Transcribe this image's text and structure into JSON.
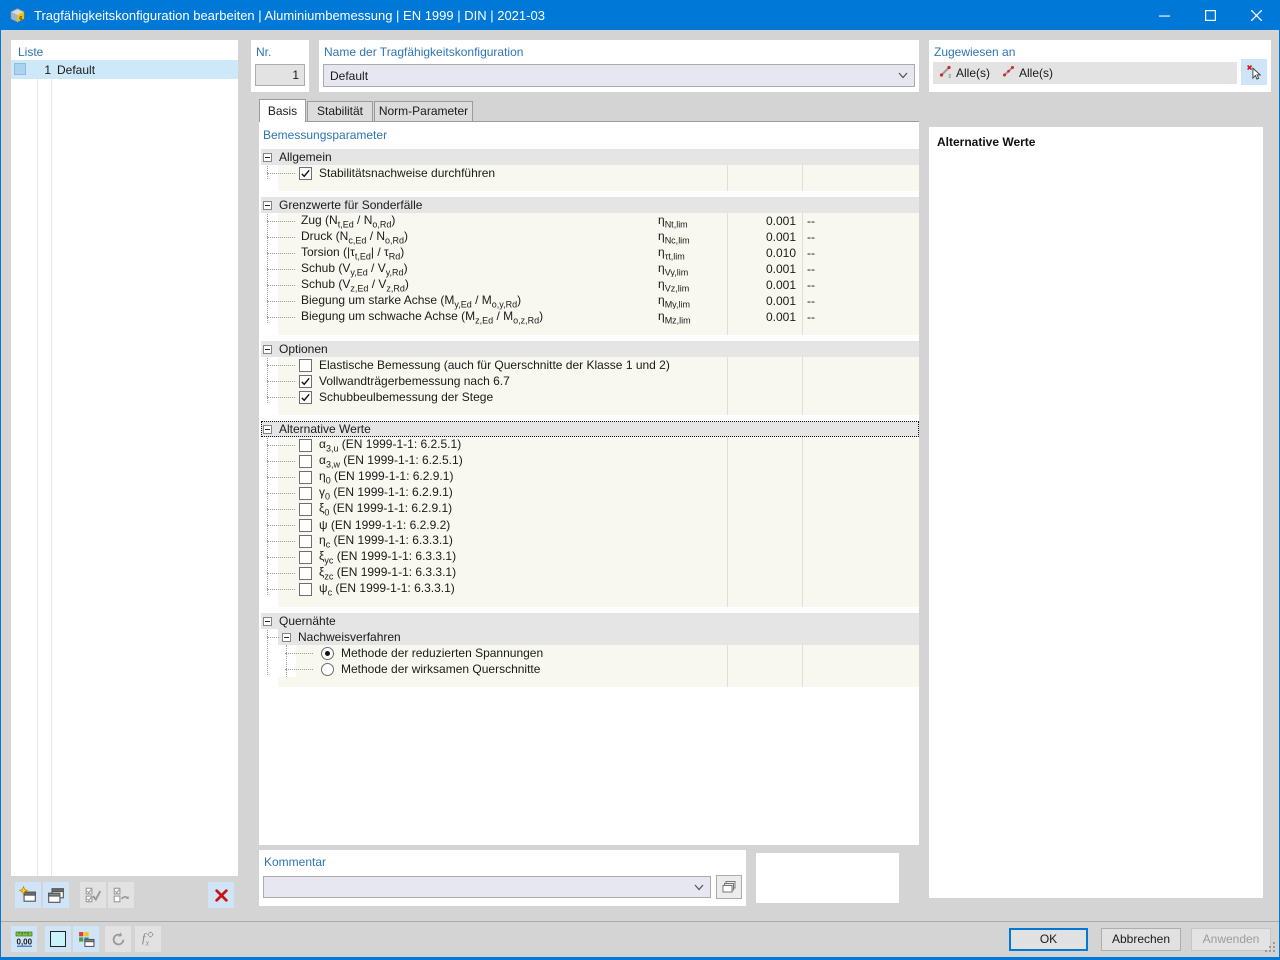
{
  "window": {
    "title": "Tragfähigkeitskonfiguration bearbeiten | Aluminiumbemessung | EN 1999 | DIN | 2021-03",
    "control_icons": [
      "minimize-icon",
      "maximize-icon",
      "close-icon"
    ],
    "app_icon": "app-icon"
  },
  "colors": {
    "titlebar": "#0078D7",
    "label_blue": "#2E74B5",
    "selection": "#CDE8F8",
    "row_bg": "#F8F8F1",
    "section_bg": "#E5E5E5",
    "button_highlight": "#CFE4F6"
  },
  "liste": {
    "header": "Liste",
    "items": [
      {
        "nr": "1",
        "name": "Default",
        "selected": true
      }
    ],
    "toolbar_icons": [
      "new-config-icon",
      "copy-config-icon",
      "apply-checks-icon",
      "reset-checks-icon",
      "delete-icon"
    ],
    "toolbar_enabled": [
      true,
      true,
      false,
      false,
      true
    ]
  },
  "header": {
    "nr_label": "Nr.",
    "nr_value": "1",
    "name_label": "Name der Tragfähigkeitskonfiguration",
    "name_value": "Default",
    "assigned_label": "Zugewiesen an",
    "assigned": [
      {
        "icon": "member-icon",
        "label": "Alle(s)"
      },
      {
        "icon": "member-set-icon",
        "label": "Alle(s)"
      }
    ],
    "select_icon": "pointer-select-icon"
  },
  "tabs": [
    {
      "label": "Basis",
      "active": true
    },
    {
      "label": "Stabilität",
      "active": false
    },
    {
      "label": "Norm-Parameter",
      "active": false
    }
  ],
  "params": {
    "title": "Bemessungsparameter",
    "sections": [
      {
        "label": "Allgemein",
        "rows": [
          {
            "type": "check",
            "checked": true,
            "label": [
              [
                "t",
                "Stabilitätsnachweise durchführen"
              ]
            ]
          }
        ]
      },
      {
        "label": "Grenzwerte für Sonderfälle",
        "rows": [
          {
            "type": "value",
            "label": [
              [
                "t",
                "Zug (N"
              ],
              [
                "s",
                "t,Ed"
              ],
              [
                "t",
                " / N"
              ],
              [
                "s",
                "o,Rd"
              ],
              [
                "t",
                ")"
              ]
            ],
            "sym": [
              [
                "t",
                "η"
              ],
              [
                "s",
                "Nt,lim"
              ]
            ],
            "value": "0.001",
            "unit": "--"
          },
          {
            "type": "value",
            "label": [
              [
                "t",
                "Druck (N"
              ],
              [
                "s",
                "c,Ed"
              ],
              [
                "t",
                " / N"
              ],
              [
                "s",
                "o,Rd"
              ],
              [
                "t",
                ")"
              ]
            ],
            "sym": [
              [
                "t",
                "η"
              ],
              [
                "s",
                "Nc,lim"
              ]
            ],
            "value": "0.001",
            "unit": "--"
          },
          {
            "type": "value",
            "label": [
              [
                "t",
                "Torsion (|τ"
              ],
              [
                "s",
                "t,Ed"
              ],
              [
                "t",
                "| / τ"
              ],
              [
                "s",
                "Rd"
              ],
              [
                "t",
                ")"
              ]
            ],
            "sym": [
              [
                "t",
                "η"
              ],
              [
                "s",
                "τt,lim"
              ]
            ],
            "value": "0.010",
            "unit": "--"
          },
          {
            "type": "value",
            "label": [
              [
                "t",
                "Schub (V"
              ],
              [
                "s",
                "y,Ed"
              ],
              [
                "t",
                " / V"
              ],
              [
                "s",
                "y,Rd"
              ],
              [
                "t",
                ")"
              ]
            ],
            "sym": [
              [
                "t",
                "η"
              ],
              [
                "s",
                "Vy,lim"
              ]
            ],
            "value": "0.001",
            "unit": "--"
          },
          {
            "type": "value",
            "label": [
              [
                "t",
                "Schub (V"
              ],
              [
                "s",
                "z,Ed"
              ],
              [
                "t",
                " / V"
              ],
              [
                "s",
                "z,Rd"
              ],
              [
                "t",
                ")"
              ]
            ],
            "sym": [
              [
                "t",
                "η"
              ],
              [
                "s",
                "Vz,lim"
              ]
            ],
            "value": "0.001",
            "unit": "--"
          },
          {
            "type": "value",
            "label": [
              [
                "t",
                "Biegung um starke Achse (M"
              ],
              [
                "s",
                "y,Ed"
              ],
              [
                "t",
                " / M"
              ],
              [
                "s",
                "o,y,Rd"
              ],
              [
                "t",
                ")"
              ]
            ],
            "sym": [
              [
                "t",
                "η"
              ],
              [
                "s",
                "My,lim"
              ]
            ],
            "value": "0.001",
            "unit": "--"
          },
          {
            "type": "value",
            "label": [
              [
                "t",
                "Biegung um schwache Achse (M"
              ],
              [
                "s",
                "z,Ed"
              ],
              [
                "t",
                " / M"
              ],
              [
                "s",
                "o,z,Rd"
              ],
              [
                "t",
                ")"
              ]
            ],
            "sym": [
              [
                "t",
                "η"
              ],
              [
                "s",
                "Mz,lim"
              ]
            ],
            "value": "0.001",
            "unit": "--"
          }
        ]
      },
      {
        "label": "Optionen",
        "rows": [
          {
            "type": "check",
            "checked": false,
            "label": [
              [
                "t",
                "Elastische Bemessung (auch für Querschnitte der Klasse 1 und 2)"
              ]
            ]
          },
          {
            "type": "check",
            "checked": true,
            "label": [
              [
                "t",
                "Vollwandträgerbemessung nach 6.7"
              ]
            ]
          },
          {
            "type": "check",
            "checked": true,
            "label": [
              [
                "t",
                "Schubbeulbemessung der Stege"
              ]
            ]
          }
        ]
      },
      {
        "label": "Alternative Werte",
        "focused": true,
        "rows": [
          {
            "type": "check",
            "checked": false,
            "label": [
              [
                "t",
                "α"
              ],
              [
                "s",
                "3,u"
              ],
              [
                "t",
                " (EN 1999-1-1: 6.2.5.1)"
              ]
            ]
          },
          {
            "type": "check",
            "checked": false,
            "label": [
              [
                "t",
                "α"
              ],
              [
                "s",
                "3,w"
              ],
              [
                "t",
                " (EN 1999-1-1: 6.2.5.1)"
              ]
            ]
          },
          {
            "type": "check",
            "checked": false,
            "label": [
              [
                "t",
                "η"
              ],
              [
                "s",
                "0"
              ],
              [
                "t",
                " (EN 1999-1-1: 6.2.9.1)"
              ]
            ]
          },
          {
            "type": "check",
            "checked": false,
            "label": [
              [
                "t",
                "γ"
              ],
              [
                "s",
                "0"
              ],
              [
                "t",
                " (EN 1999-1-1: 6.2.9.1)"
              ]
            ]
          },
          {
            "type": "check",
            "checked": false,
            "label": [
              [
                "t",
                "ξ"
              ],
              [
                "s",
                "0"
              ],
              [
                "t",
                " (EN 1999-1-1: 6.2.9.1)"
              ]
            ]
          },
          {
            "type": "check",
            "checked": false,
            "label": [
              [
                "t",
                "ψ (EN 1999-1-1: 6.2.9.2)"
              ]
            ]
          },
          {
            "type": "check",
            "checked": false,
            "label": [
              [
                "t",
                "η"
              ],
              [
                "s",
                "c"
              ],
              [
                "t",
                " (EN 1999-1-1: 6.3.3.1)"
              ]
            ]
          },
          {
            "type": "check",
            "checked": false,
            "label": [
              [
                "t",
                "ξ"
              ],
              [
                "s",
                "yc"
              ],
              [
                "t",
                " (EN 1999-1-1: 6.3.3.1)"
              ]
            ]
          },
          {
            "type": "check",
            "checked": false,
            "label": [
              [
                "t",
                "ξ"
              ],
              [
                "s",
                "zc"
              ],
              [
                "t",
                " (EN 1999-1-1: 6.3.3.1)"
              ]
            ]
          },
          {
            "type": "check",
            "checked": false,
            "label": [
              [
                "t",
                "ψ"
              ],
              [
                "s",
                "c"
              ],
              [
                "t",
                " (EN 1999-1-1: 6.3.3.1)"
              ]
            ]
          }
        ]
      },
      {
        "label": "Quernähte",
        "rows": [
          {
            "type": "subheader",
            "label": [
              [
                "t",
                "Nachweisverfahren"
              ]
            ]
          },
          {
            "type": "radio",
            "checked": true,
            "label": [
              [
                "t",
                "Methode der reduzierten Spannungen"
              ]
            ]
          },
          {
            "type": "radio",
            "checked": false,
            "label": [
              [
                "t",
                "Methode der wirksamen Querschnitte"
              ]
            ]
          }
        ]
      }
    ]
  },
  "right_panel": {
    "title": "Alternative Werte"
  },
  "comment": {
    "label": "Kommentar",
    "value": "",
    "copy_icon": "copy-comment-icon"
  },
  "footer_toolbar_icons": [
    "units-icon",
    "color-swatch-icon",
    "display-properties-icon",
    "undo-icon",
    "function-icon"
  ],
  "footer_toolbar_enabled": [
    true,
    true,
    true,
    false,
    false
  ],
  "footer": {
    "ok_label": "OK",
    "cancel_label": "Abbrechen",
    "apply_label": "Anwenden"
  }
}
